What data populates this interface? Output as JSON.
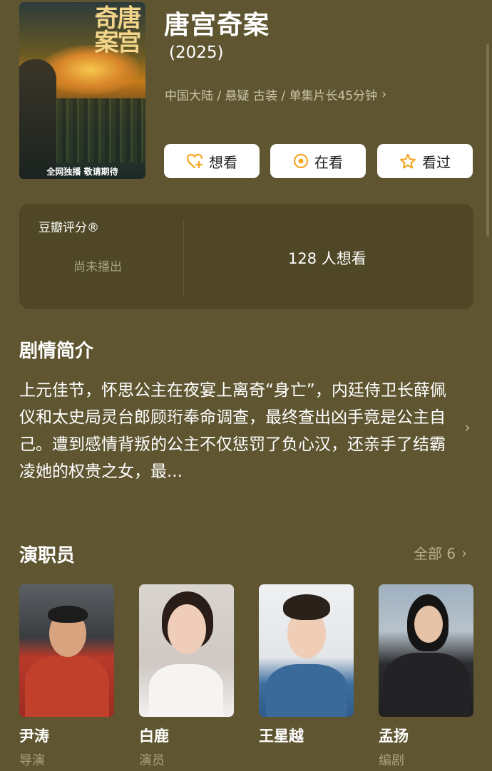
{
  "movie": {
    "title": "唐宫奇案",
    "year": "(2025)",
    "meta": "中国大陆 / 悬疑 古装 / 单集片长45分钟",
    "poster": {
      "calligraphy": "唐宫奇案",
      "caption": "全网独播 敬请期待"
    }
  },
  "actions": [
    {
      "label": "想看",
      "icon": "heart-plus-icon",
      "color": "#f5a623"
    },
    {
      "label": "在看",
      "icon": "target-icon",
      "color": "#f5a623"
    },
    {
      "label": "看过",
      "icon": "star-icon",
      "color": "#f5a623"
    }
  ],
  "rating": {
    "label": "豆瓣评分®",
    "status": "尚未播出",
    "want_count": "128 人想看"
  },
  "synopsis": {
    "title": "剧情简介",
    "text": "上元佳节，怀思公主在夜宴上离奇“身亡”，内廷侍卫长薛佩仪和太史局灵台郎顾珩奉命调查，最终查出凶手竟是公主自己。遭到感情背叛的公主不仅惩罚了负心汉，还亲手了结霸凌她的权贵之女，最..."
  },
  "cast": {
    "title": "演职员",
    "all_label": "全部 6",
    "members": [
      {
        "name": "尹涛",
        "role": "导演"
      },
      {
        "name": "白鹿",
        "role": "演员"
      },
      {
        "name": "王星越",
        "role": ""
      },
      {
        "name": "孟扬",
        "role": "编剧"
      }
    ]
  }
}
